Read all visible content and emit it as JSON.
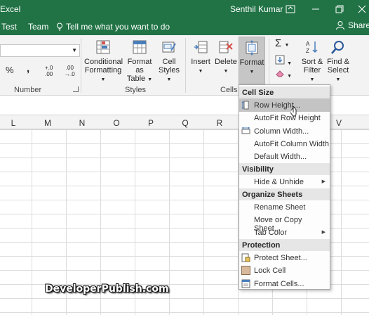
{
  "titlebar": {
    "app_title": "Excel",
    "user_name": "Senthil Kumar"
  },
  "tabs": {
    "test": "Test",
    "team": "Team",
    "tell_me": "Tell me what you want to do",
    "share": "Share"
  },
  "ribbon": {
    "percent_symbol": "%",
    "comma_symbol": ",",
    "increase_decimal": ".00",
    "increase_decimal_sub": "+.0",
    "decrease_decimal": ".00",
    "decrease_decimal_sub": "→.0",
    "number_group_label": "Number",
    "conditional_formatting": {
      "line1": "Conditional",
      "line2": "Formatting"
    },
    "format_as_table": {
      "line1": "Format as",
      "line2": "Table"
    },
    "cell_styles": {
      "line1": "Cell",
      "line2": "Styles"
    },
    "styles_group_label": "Styles",
    "insert": "Insert",
    "delete": "Delete",
    "format": "Format",
    "cells_group_label": "Cells",
    "sort_filter": {
      "line1": "Sort &",
      "line2": "Filter"
    },
    "find_select": {
      "line1": "Find &",
      "line2": "Select"
    }
  },
  "columns": [
    "L",
    "M",
    "N",
    "O",
    "P",
    "Q",
    "R",
    "V"
  ],
  "format_menu": {
    "cell_size_header": "Cell Size",
    "row_height": "Row Height...",
    "autofit_row_height": "AutoFit Row Height",
    "column_width": "Column Width...",
    "autofit_column_width": "AutoFit Column Width",
    "default_width": "Default Width...",
    "visibility_header": "Visibility",
    "hide_unhide": "Hide & Unhide",
    "organize_sheets_header": "Organize Sheets",
    "rename_sheet": "Rename Sheet",
    "move_copy_sheet": "Move or Copy Sheet...",
    "tab_color": "Tab Color",
    "protection_header": "Protection",
    "protect_sheet": "Protect Sheet...",
    "lock_cell": "Lock Cell",
    "format_cells": "Format Cells..."
  },
  "watermark": "DeveloperPublish.com",
  "colors": {
    "excel_green": "#217346",
    "ribbon_bg": "#f3f3f3",
    "menu_highlight": "#c4c4c4"
  }
}
